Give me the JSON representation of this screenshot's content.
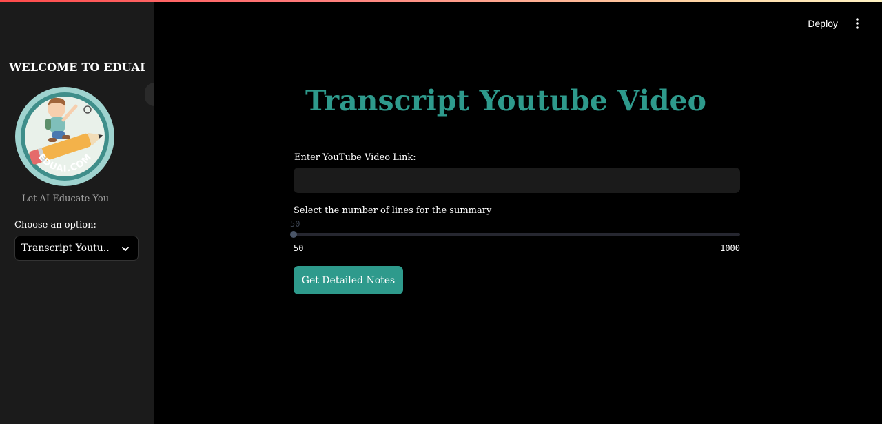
{
  "sidebar": {
    "title": "WELCOME TO EDUAI",
    "logo_text": "EDUAI.COM",
    "tagline": "Let AI Educate You",
    "choose_label": "Choose an option:",
    "selected_option": "Transcript Youtu...",
    "chevron_icon": "chevron-down-icon"
  },
  "header": {
    "deploy_label": "Deploy",
    "menu_icon": "kebab-menu-icon"
  },
  "main": {
    "title": "Transcript Youtube Video",
    "link_label": "Enter YouTube Video Link:",
    "link_value": "",
    "slider": {
      "label": "Select the number of lines for the summary",
      "current_value": "50",
      "min_label": "50",
      "max_label": "1000",
      "fraction": 0
    },
    "button_label": "Get Detailed Notes"
  },
  "colors": {
    "accent": "#2e9a8c",
    "sidebar_bg": "#1b1b1b",
    "main_bg": "#000000",
    "input_bg": "#1b1b1b"
  }
}
